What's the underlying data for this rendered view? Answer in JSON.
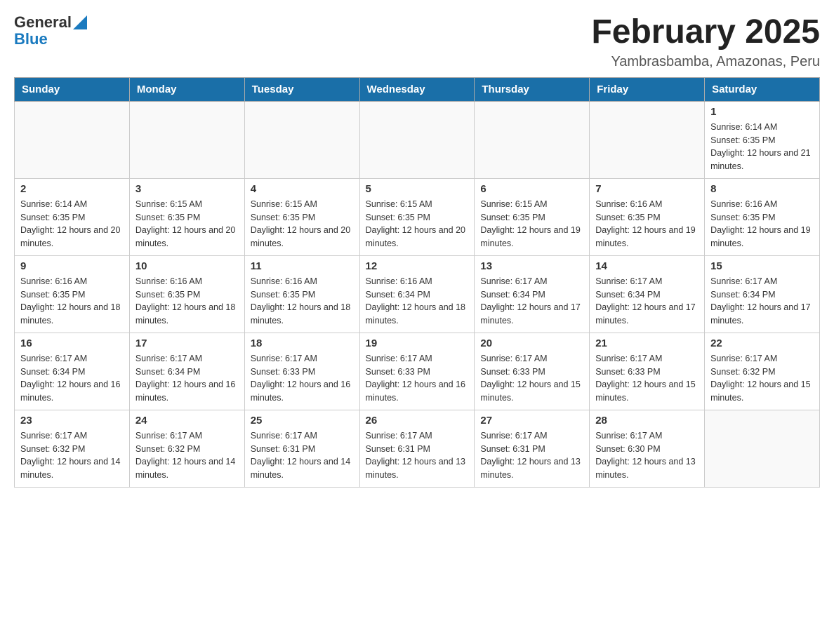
{
  "header": {
    "logo_general": "General",
    "logo_blue": "Blue",
    "month_title": "February 2025",
    "location": "Yambrasbamba, Amazonas, Peru"
  },
  "days_of_week": [
    "Sunday",
    "Monday",
    "Tuesday",
    "Wednesday",
    "Thursday",
    "Friday",
    "Saturday"
  ],
  "weeks": [
    {
      "days": [
        {
          "num": "",
          "info": ""
        },
        {
          "num": "",
          "info": ""
        },
        {
          "num": "",
          "info": ""
        },
        {
          "num": "",
          "info": ""
        },
        {
          "num": "",
          "info": ""
        },
        {
          "num": "",
          "info": ""
        },
        {
          "num": "1",
          "info": "Sunrise: 6:14 AM\nSunset: 6:35 PM\nDaylight: 12 hours and 21 minutes."
        }
      ]
    },
    {
      "days": [
        {
          "num": "2",
          "info": "Sunrise: 6:14 AM\nSunset: 6:35 PM\nDaylight: 12 hours and 20 minutes."
        },
        {
          "num": "3",
          "info": "Sunrise: 6:15 AM\nSunset: 6:35 PM\nDaylight: 12 hours and 20 minutes."
        },
        {
          "num": "4",
          "info": "Sunrise: 6:15 AM\nSunset: 6:35 PM\nDaylight: 12 hours and 20 minutes."
        },
        {
          "num": "5",
          "info": "Sunrise: 6:15 AM\nSunset: 6:35 PM\nDaylight: 12 hours and 20 minutes."
        },
        {
          "num": "6",
          "info": "Sunrise: 6:15 AM\nSunset: 6:35 PM\nDaylight: 12 hours and 19 minutes."
        },
        {
          "num": "7",
          "info": "Sunrise: 6:16 AM\nSunset: 6:35 PM\nDaylight: 12 hours and 19 minutes."
        },
        {
          "num": "8",
          "info": "Sunrise: 6:16 AM\nSunset: 6:35 PM\nDaylight: 12 hours and 19 minutes."
        }
      ]
    },
    {
      "days": [
        {
          "num": "9",
          "info": "Sunrise: 6:16 AM\nSunset: 6:35 PM\nDaylight: 12 hours and 18 minutes."
        },
        {
          "num": "10",
          "info": "Sunrise: 6:16 AM\nSunset: 6:35 PM\nDaylight: 12 hours and 18 minutes."
        },
        {
          "num": "11",
          "info": "Sunrise: 6:16 AM\nSunset: 6:35 PM\nDaylight: 12 hours and 18 minutes."
        },
        {
          "num": "12",
          "info": "Sunrise: 6:16 AM\nSunset: 6:34 PM\nDaylight: 12 hours and 18 minutes."
        },
        {
          "num": "13",
          "info": "Sunrise: 6:17 AM\nSunset: 6:34 PM\nDaylight: 12 hours and 17 minutes."
        },
        {
          "num": "14",
          "info": "Sunrise: 6:17 AM\nSunset: 6:34 PM\nDaylight: 12 hours and 17 minutes."
        },
        {
          "num": "15",
          "info": "Sunrise: 6:17 AM\nSunset: 6:34 PM\nDaylight: 12 hours and 17 minutes."
        }
      ]
    },
    {
      "days": [
        {
          "num": "16",
          "info": "Sunrise: 6:17 AM\nSunset: 6:34 PM\nDaylight: 12 hours and 16 minutes."
        },
        {
          "num": "17",
          "info": "Sunrise: 6:17 AM\nSunset: 6:34 PM\nDaylight: 12 hours and 16 minutes."
        },
        {
          "num": "18",
          "info": "Sunrise: 6:17 AM\nSunset: 6:33 PM\nDaylight: 12 hours and 16 minutes."
        },
        {
          "num": "19",
          "info": "Sunrise: 6:17 AM\nSunset: 6:33 PM\nDaylight: 12 hours and 16 minutes."
        },
        {
          "num": "20",
          "info": "Sunrise: 6:17 AM\nSunset: 6:33 PM\nDaylight: 12 hours and 15 minutes."
        },
        {
          "num": "21",
          "info": "Sunrise: 6:17 AM\nSunset: 6:33 PM\nDaylight: 12 hours and 15 minutes."
        },
        {
          "num": "22",
          "info": "Sunrise: 6:17 AM\nSunset: 6:32 PM\nDaylight: 12 hours and 15 minutes."
        }
      ]
    },
    {
      "days": [
        {
          "num": "23",
          "info": "Sunrise: 6:17 AM\nSunset: 6:32 PM\nDaylight: 12 hours and 14 minutes."
        },
        {
          "num": "24",
          "info": "Sunrise: 6:17 AM\nSunset: 6:32 PM\nDaylight: 12 hours and 14 minutes."
        },
        {
          "num": "25",
          "info": "Sunrise: 6:17 AM\nSunset: 6:31 PM\nDaylight: 12 hours and 14 minutes."
        },
        {
          "num": "26",
          "info": "Sunrise: 6:17 AM\nSunset: 6:31 PM\nDaylight: 12 hours and 13 minutes."
        },
        {
          "num": "27",
          "info": "Sunrise: 6:17 AM\nSunset: 6:31 PM\nDaylight: 12 hours and 13 minutes."
        },
        {
          "num": "28",
          "info": "Sunrise: 6:17 AM\nSunset: 6:30 PM\nDaylight: 12 hours and 13 minutes."
        },
        {
          "num": "",
          "info": ""
        }
      ]
    }
  ]
}
